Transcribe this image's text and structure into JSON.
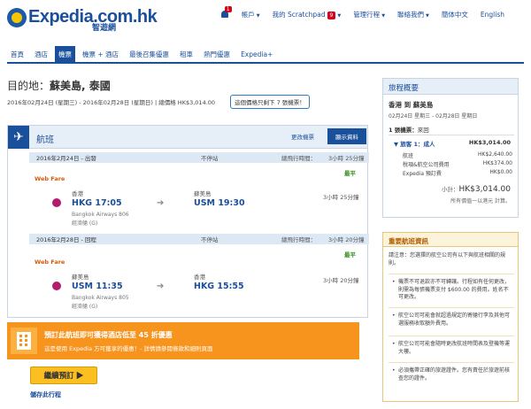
{
  "header": {
    "logo_text": "Expedia.com.hk",
    "logo_sub": "智遊網",
    "notification_count": "1",
    "account": "帳戶",
    "scratchpad": "我的 Scratchpad",
    "scratchpad_count": "9",
    "manage_trips": "管理行程",
    "contact": "聯絡我們",
    "language_tc": "簡体中文",
    "language_en": "English"
  },
  "nav": {
    "items": [
      "首頁",
      "酒店",
      "機票",
      "機票 + 酒店",
      "最後召集優惠",
      "租車",
      "熱門優惠",
      "Expedia+"
    ]
  },
  "destination": {
    "label": "目的地：",
    "value": "蘇美島, 泰國",
    "dates": "2016年02月24日 (星期三) - 2016年02月28日 (星期日) | 總價格 HK$3,014.00",
    "seats_left": "這個價格只剩下 7 張機票！"
  },
  "flight_panel": {
    "title": "航班",
    "change_flight": "更改機票",
    "show_details": "顯示資料",
    "outbound": {
      "date": "2016年2月24日 - 出發",
      "stops": "不停站",
      "total_time_label": "總飛行時間：",
      "total_time": "3小時 25分鐘",
      "fare": "Web Fare",
      "cheapest": "最平",
      "from_city": "香港",
      "from_time": "HKG 17:05",
      "airline": "Bangkok Airways 806",
      "cabin": "經濟艙 (G)",
      "to_city": "蘇美島",
      "to_time": "USM 19:30",
      "duration": "3小時 25分鐘"
    },
    "return": {
      "date": "2016年2月28日 - 回程",
      "stops": "不停站",
      "total_time_label": "總飛行時間：",
      "total_time": "3小時 20分鐘",
      "fare": "Web Fare",
      "cheapest": "最平",
      "from_city": "蘇美島",
      "from_time": "USM 11:35",
      "airline": "Bangkok Airways 805",
      "cabin": "經濟艙 (G)",
      "to_city": "香港",
      "to_time": "HKG 15:55",
      "duration": "3小時 20分鐘"
    }
  },
  "hotel_banner": {
    "title": "預訂此航班即可獲得酒店低至 45 折優惠",
    "subtitle": "這是使用 Expedia 方可獲享的優惠！- 詳情請參閱條款和細則頁面"
  },
  "continue_button": "繼續預訂 ▶",
  "save_trip": "儲存此行程",
  "trip_summary": {
    "title": "旅程概要",
    "route": "香港 到 蘇美島",
    "dates": "02月24日 星期三 - 02月28日 星期日",
    "tickets_prefix": "1 張機票：",
    "tickets_type": "來回",
    "traveler": "旅客 1：成人",
    "traveler_total": "HK$3,014.00",
    "rows": [
      {
        "label": "航班",
        "value": "HK$2,640.00"
      },
      {
        "label": "稅項&航空公司費用",
        "value": "HK$374.00"
      },
      {
        "label": "Expedia 預訂費",
        "value": "HK$0.00"
      }
    ],
    "subtotal_label": "小計：",
    "subtotal": "HK$3,014.00",
    "note": "所有價值一以港元 計算。"
  },
  "rules": {
    "title": "重要航班資訊",
    "intro": "請注意：您選擇的航空公司有以下與航班相關的規則。",
    "items": [
      "機票不可退款亦不可轉讓。行程如有任何更改，則需為每張機票支付 $600.00 的費用。姓名不可更改。",
      "航空公司可能會就超過規定的寄艙行李及其他可選服務收取額外費用。",
      "航空公司可能會隨時更改航班時間表及登機等運大樓。",
      "必須攜帶正確的旅遊證件。您有責任於旅遊前核查您的證件。"
    ],
    "link_more": "額外費用"
  }
}
